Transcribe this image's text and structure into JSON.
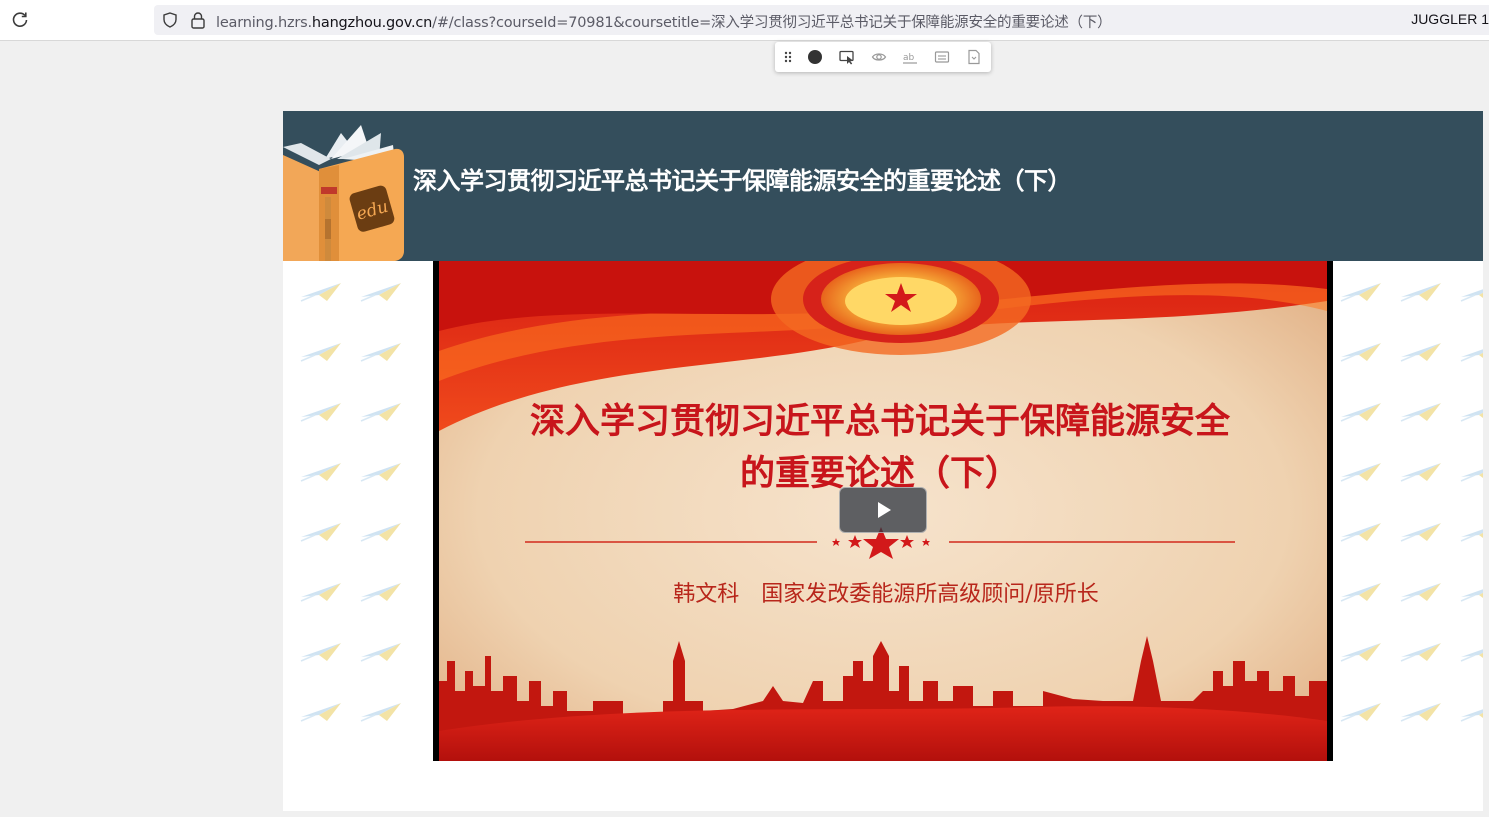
{
  "browser": {
    "url_prefix": "learning.hzrs.",
    "url_host": "hangzhou.gov.cn",
    "url_path": "/#/class?courseId=70981&coursetitle=深入学习贯彻习近平总书记关于保障能源安全的重要论述（下）",
    "profile_label": "JUGGLER 1",
    "icons": [
      "reload-icon",
      "shield-icon",
      "lock-icon"
    ]
  },
  "floating_toolbar": {
    "icons": [
      "drag-handle-icon",
      "record-icon",
      "select-icon",
      "eye-icon",
      "text-abc-icon",
      "subtitle-icon",
      "document-icon"
    ]
  },
  "course": {
    "header_title": "深入学习贯彻习近平总书记关于保障能源安全的重要论述（下）",
    "logo_text": "edu",
    "header_color": "#344e5c"
  },
  "video": {
    "slide_title_line1": "深入学习贯彻习近平总书记关于保障能源安全",
    "slide_title_line2": "的重要论述（下）",
    "speaker": "韩文科　国家发改委能源所高级顾问/原所长",
    "play_icon": "play-icon",
    "accent_color": "#c8151b"
  }
}
